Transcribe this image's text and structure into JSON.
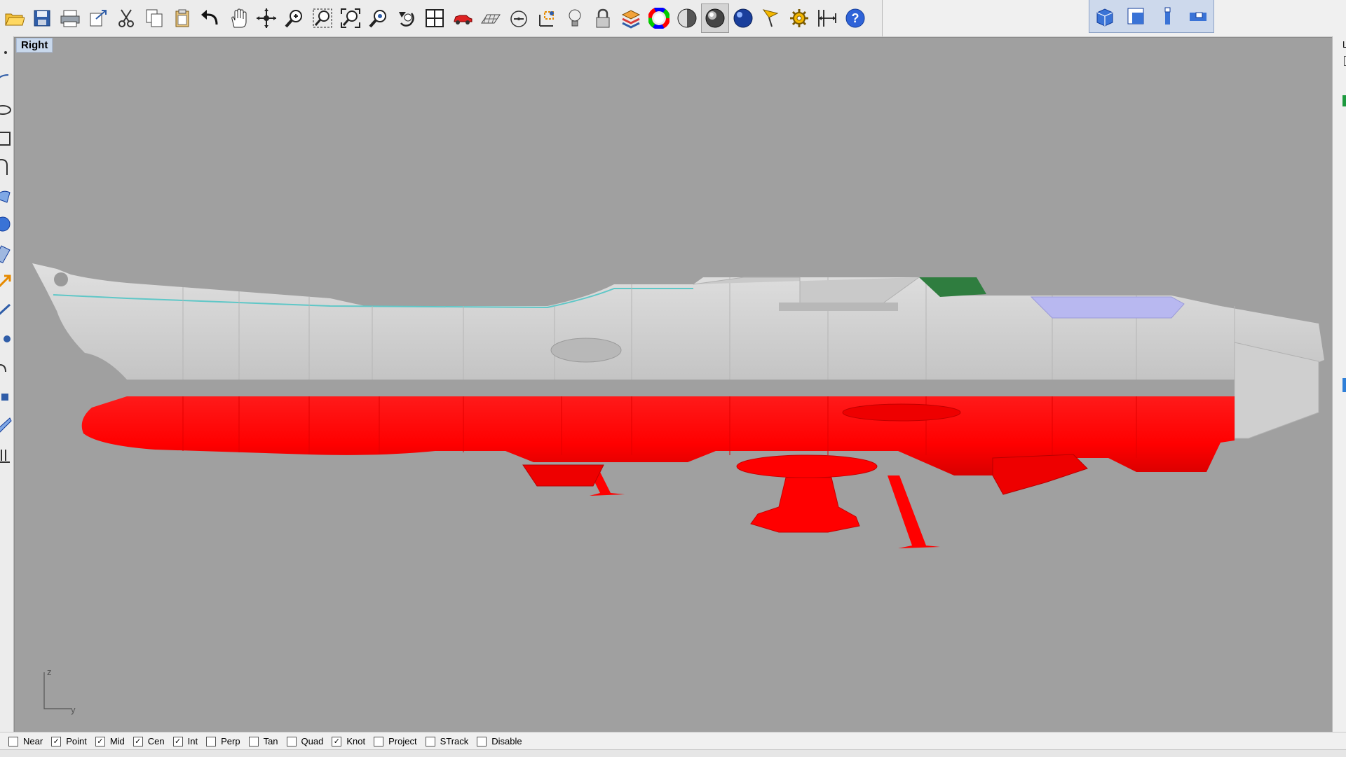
{
  "toolbar": {
    "buttons": [
      {
        "name": "open-icon"
      },
      {
        "name": "save-icon"
      },
      {
        "name": "print-icon"
      },
      {
        "name": "export-icon"
      },
      {
        "name": "cut-icon"
      },
      {
        "name": "copy-icon"
      },
      {
        "name": "paste-icon"
      },
      {
        "name": "undo-icon"
      },
      {
        "name": "pan-hand-icon"
      },
      {
        "name": "rotate-view-icon"
      },
      {
        "name": "zoom-icon"
      },
      {
        "name": "zoom-window-icon"
      },
      {
        "name": "zoom-extents-icon"
      },
      {
        "name": "zoom-selected-icon"
      },
      {
        "name": "undo-view-icon"
      },
      {
        "name": "four-viewports-icon"
      },
      {
        "name": "car-icon"
      },
      {
        "name": "grid-plane-icon"
      },
      {
        "name": "circle-snap-icon"
      },
      {
        "name": "gumball-icon"
      },
      {
        "name": "lightbulb-icon"
      },
      {
        "name": "lock-icon"
      },
      {
        "name": "layer-icon"
      },
      {
        "name": "color-wheel-icon"
      },
      {
        "name": "shaded-sphere-icon"
      },
      {
        "name": "rendered-sphere-icon"
      },
      {
        "name": "render-icon"
      },
      {
        "name": "flag-icon"
      },
      {
        "name": "gear-settings-icon"
      },
      {
        "name": "dimension-icon"
      },
      {
        "name": "help-icon"
      }
    ]
  },
  "viewport_tabs": [
    {
      "name": "perspective-view-icon"
    },
    {
      "name": "top-view-icon"
    },
    {
      "name": "front-view-icon"
    },
    {
      "name": "right-view-icon"
    }
  ],
  "viewport": {
    "label": "Right",
    "axis_labels": {
      "vertical": "z",
      "horizontal": "y"
    },
    "background": "#a0a0a0"
  },
  "model_colors": {
    "hull": "#d2d2d2",
    "lower_hull": "#ff0000",
    "green_panel": "#2f7d3f",
    "lavender_panel": "#b8b8f0"
  },
  "right_panel": {
    "letter": "L"
  },
  "osnaps": [
    {
      "label": "Near",
      "checked": false
    },
    {
      "label": "Point",
      "checked": true
    },
    {
      "label": "Mid",
      "checked": true
    },
    {
      "label": "Cen",
      "checked": true
    },
    {
      "label": "Int",
      "checked": true
    },
    {
      "label": "Perp",
      "checked": false
    },
    {
      "label": "Tan",
      "checked": false
    },
    {
      "label": "Quad",
      "checked": false
    },
    {
      "label": "Knot",
      "checked": true
    },
    {
      "label": "Project",
      "checked": false
    },
    {
      "label": "STrack",
      "checked": false
    },
    {
      "label": "Disable",
      "checked": false
    }
  ]
}
